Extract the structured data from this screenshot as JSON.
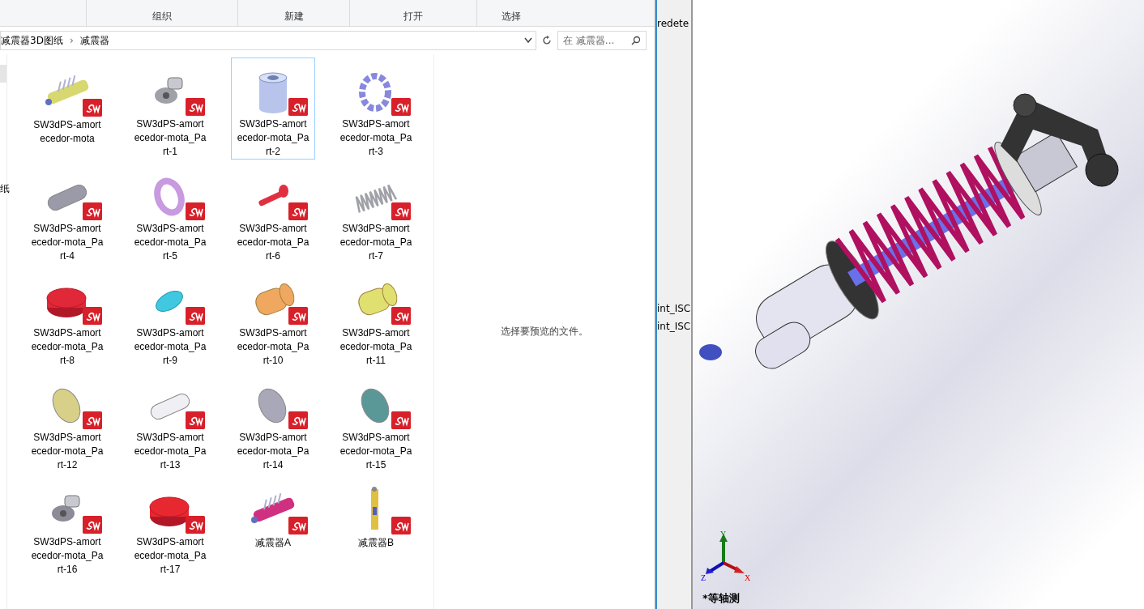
{
  "ribbon": {
    "groups": [
      "组织",
      "新建",
      "打开",
      "选择"
    ]
  },
  "address_bar": {
    "crumbs": [
      "减震器3D图纸",
      "减震器"
    ],
    "separator": "›",
    "search_placeholder": "在 减震器..."
  },
  "nav_pane": {
    "fragment": "纸"
  },
  "files": [
    {
      "name": "SW3dPS-amortecedor-mota",
      "kind": "assembly",
      "color": "#d8d870",
      "selected": false
    },
    {
      "name": "SW3dPS-amortecedor-mota_Part-1",
      "kind": "bracket",
      "color": "#a0a0a8",
      "selected": false
    },
    {
      "name": "SW3dPS-amortecedor-mota_Part-2",
      "kind": "tube",
      "color": "#b8c4ec",
      "selected": true
    },
    {
      "name": "SW3dPS-amortecedor-mota_Part-3",
      "kind": "ring",
      "color": "#8888dd",
      "selected": false
    },
    {
      "name": "SW3dPS-amortecedor-mota_Part-4",
      "kind": "rod",
      "color": "#9a9aa8",
      "selected": false
    },
    {
      "name": "SW3dPS-amortecedor-mota_Part-5",
      "kind": "washer",
      "color": "#c89ae0",
      "selected": false
    },
    {
      "name": "SW3dPS-amortecedor-mota_Part-6",
      "kind": "pin",
      "color": "#e03040",
      "selected": false
    },
    {
      "name": "SW3dPS-amortecedor-mota_Part-7",
      "kind": "spring",
      "color": "#a0a0a8",
      "selected": false
    },
    {
      "name": "SW3dPS-amortecedor-mota_Part-8",
      "kind": "puck",
      "color": "#e02838",
      "selected": false
    },
    {
      "name": "SW3dPS-amortecedor-mota_Part-9",
      "kind": "lens",
      "color": "#40c8e0",
      "selected": false
    },
    {
      "name": "SW3dPS-amortecedor-mota_Part-10",
      "kind": "drum",
      "color": "#f0a860",
      "selected": false
    },
    {
      "name": "SW3dPS-amortecedor-mota_Part-11",
      "kind": "drum",
      "color": "#e0e070",
      "selected": false
    },
    {
      "name": "SW3dPS-amortecedor-mota_Part-12",
      "kind": "disc",
      "color": "#d8d088",
      "selected": false
    },
    {
      "name": "SW3dPS-amortecedor-mota_Part-13",
      "kind": "rod",
      "color": "#f0f0f4",
      "selected": false
    },
    {
      "name": "SW3dPS-amortecedor-mota_Part-14",
      "kind": "disc",
      "color": "#a8a8b8",
      "selected": false
    },
    {
      "name": "SW3dPS-amortecedor-mota_Part-15",
      "kind": "disc",
      "color": "#5a9898",
      "selected": false
    },
    {
      "name": "SW3dPS-amortecedor-mota_Part-16",
      "kind": "bracket",
      "color": "#8c8c98",
      "selected": false
    },
    {
      "name": "SW3dPS-amortecedor-mota_Part-17",
      "kind": "puck",
      "color": "#e82830",
      "selected": false
    },
    {
      "name": "减震器A",
      "kind": "assembly",
      "color": "#d03080",
      "selected": false
    },
    {
      "name": "减震器B",
      "kind": "vertical",
      "color": "#e0c040",
      "selected": false
    }
  ],
  "preview_pane": {
    "message": "选择要预览的文件。"
  },
  "cad_panel": {
    "items": [
      "redete",
      "int_ISC",
      "int_ISC"
    ]
  },
  "viewport": {
    "axes": [
      "X",
      "Y",
      "Z"
    ],
    "view_name": "*等轴测"
  }
}
